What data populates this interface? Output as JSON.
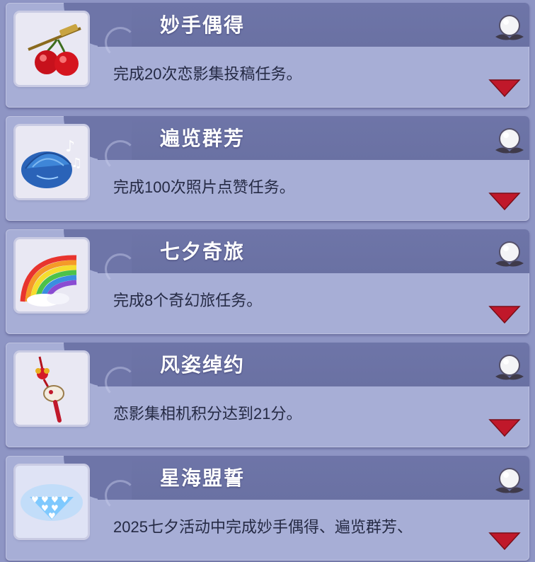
{
  "achievements": [
    {
      "title": "妙手偶得",
      "description": "完成20次恋影集投稿任务。",
      "icon": "cherries-icon",
      "reward_icon": "pearl-icon"
    },
    {
      "title": "遍览群芳",
      "description": "完成100次照片点赞任务。",
      "icon": "seashell-icon",
      "reward_icon": "pearl-icon"
    },
    {
      "title": "七夕奇旅",
      "description": "完成8个奇幻旅任务。",
      "icon": "rainbow-icon",
      "reward_icon": "pearl-icon"
    },
    {
      "title": "风姿绰约",
      "description": "恋影集相机积分达到21分。",
      "icon": "charm-pendant-icon",
      "reward_icon": "pearl-icon"
    },
    {
      "title": "星海盟誓",
      "description": "2025七夕活动中完成妙手偶得、遍览群芳、",
      "icon": "glowing-hearts-icon",
      "reward_icon": "pearl-icon"
    }
  ],
  "colors": {
    "background": "#8e95c4",
    "card": "#a7aed6",
    "title_band": "#6e75a8",
    "expand_arrow": "#c0182a",
    "title_text": "#ffffff",
    "description_text": "#252a44"
  }
}
